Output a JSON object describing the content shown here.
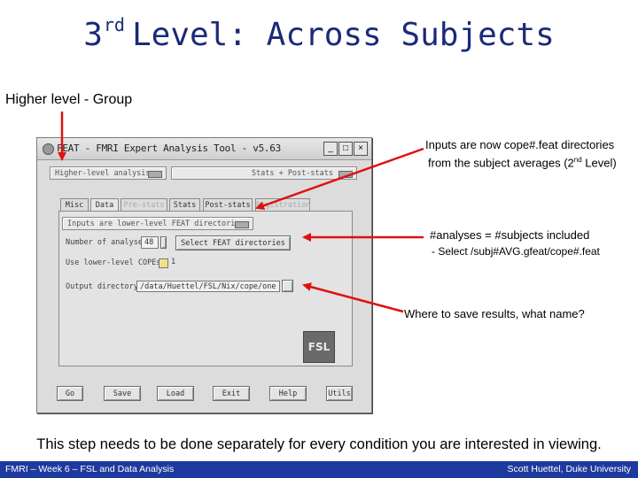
{
  "slide": {
    "title_main": "3",
    "title_sup": "rd",
    "title_rest": "Level: Across Subjects",
    "subheading": "Higher level - Group",
    "caption": "This step needs to be done separately for every condition you are interested in viewing."
  },
  "annotations": {
    "inputs_line1": "Inputs are now cope#.feat directories",
    "inputs_line2_a": "from the subject averages (2",
    "inputs_line2_sup": "nd",
    "inputs_line2_b": " Level)",
    "analyses_line1": "#analyses = #subjects included",
    "analyses_line2": "- Select /subj#AVG.gfeat/cope#.feat",
    "output": "Where to save results, what name?"
  },
  "footer": {
    "left": "FMRI – Week 6 – FSL and Data Analysis",
    "right": "Scott Huettel, Duke University"
  },
  "window": {
    "title": "FEAT - FMRI Expert Analysis Tool - v5.63",
    "level_select": "Higher-level analysis",
    "stage_select": "Stats + Post-stats",
    "tabs": [
      "Misc",
      "Data",
      "Pre-stats",
      "Stats",
      "Post-stats",
      "Registration"
    ],
    "active_tab": "Data",
    "input_type_select": "Inputs are lower-level FEAT directories",
    "analyses_label": "Number of analyses",
    "analyses_value": "48",
    "select_button": "Select FEAT directories",
    "use_lower_copes_label": "Use lower-level COPEs",
    "use_lower_copes_value": "1",
    "output_dir_label": "Output directory",
    "output_dir_value": "/data/Huettel/FSL/Nix/cope/one",
    "logo_text": "FSL",
    "bottom_buttons": [
      "Go",
      "Save",
      "Load",
      "Exit",
      "Help",
      "Utils"
    ]
  },
  "colors": {
    "title": "#1b2a78",
    "footer_bg": "#1f3a9e",
    "arrow": "#e01010"
  }
}
